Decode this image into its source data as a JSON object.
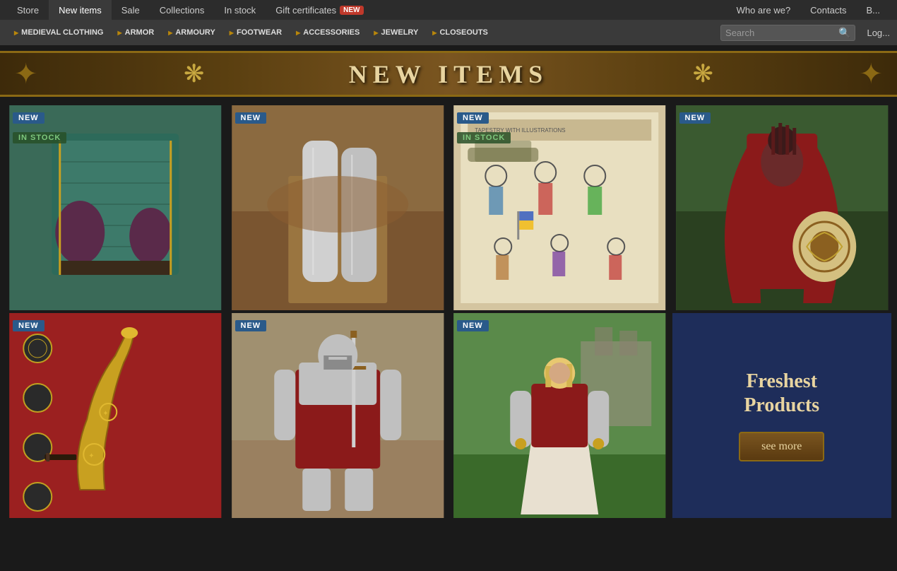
{
  "topNav": {
    "items": [
      {
        "label": "Store",
        "href": "#",
        "active": false
      },
      {
        "label": "New items",
        "href": "#",
        "active": true
      },
      {
        "label": "Sale",
        "href": "#",
        "active": false
      },
      {
        "label": "Collections",
        "href": "#",
        "active": false
      },
      {
        "label": "In stock",
        "href": "#",
        "active": false
      },
      {
        "label": "Gift certificates",
        "href": "#",
        "active": false,
        "badge": "NEW"
      },
      {
        "label": "Who are we?",
        "href": "#"
      },
      {
        "label": "Contacts",
        "href": "#"
      },
      {
        "label": "B...",
        "href": "#"
      }
    ]
  },
  "categoryNav": {
    "items": [
      {
        "label": "MEDIEVAL CLOTHING"
      },
      {
        "label": "ARMOR"
      },
      {
        "label": "ARMOURY"
      },
      {
        "label": "FOOTWEAR"
      },
      {
        "label": "ACCESSORIES"
      },
      {
        "label": "JEWELRY"
      },
      {
        "label": "CLOSEOUTS"
      }
    ]
  },
  "search": {
    "placeholder": "Search"
  },
  "loginLabel": "Log...",
  "banner": {
    "text": "NEW ITEMS"
  },
  "products": [
    {
      "id": 1,
      "badges": [
        "NEW",
        "IN STOCK"
      ],
      "color1": "#2d6a5a",
      "color2": "#8b5e3c"
    },
    {
      "id": 2,
      "badges": [
        "NEW"
      ],
      "color1": "#c0c0c0",
      "color2": "#8b5e3c"
    },
    {
      "id": 3,
      "badges": [
        "NEW",
        "IN STOCK"
      ],
      "color1": "#d4c5a0",
      "color2": "#8b7355"
    },
    {
      "id": 4,
      "badges": [
        "NEW"
      ],
      "color1": "#8b1a1a",
      "color2": "#4a3020"
    },
    {
      "id": 5,
      "badges": [
        "NEW"
      ],
      "color1": "#4a3020",
      "color2": "#c0a050"
    },
    {
      "id": 6,
      "badges": [
        "NEW"
      ],
      "color1": "#8b1a1a",
      "color2": "#c0c0c0"
    },
    {
      "id": 7,
      "badges": [
        "NEW"
      ],
      "color1": "#8b1a1a",
      "color2": "#d4d0c8"
    }
  ],
  "freshest": {
    "title": "Freshest\nProducts",
    "buttonLabel": "see more"
  }
}
